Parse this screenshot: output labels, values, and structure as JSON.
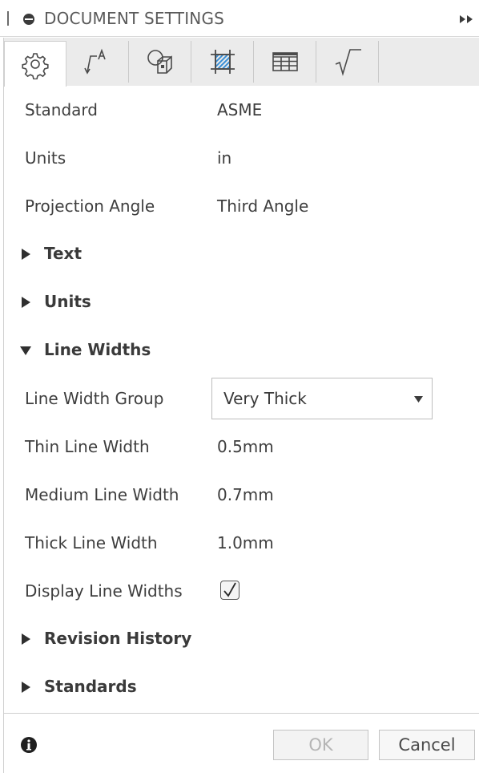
{
  "header": {
    "title": "DOCUMENT SETTINGS",
    "icons": {
      "grip": "grip-icon",
      "settings": "record-icon",
      "expand": "expand-icon"
    }
  },
  "tabs": [
    {
      "icon": "gear-icon"
    },
    {
      "icon": "text-dimension-icon"
    },
    {
      "icon": "view-projection-icon"
    },
    {
      "icon": "hatch-frame-icon"
    },
    {
      "icon": "table-icon"
    },
    {
      "icon": "square-root-icon"
    }
  ],
  "general": {
    "standard_label": "Standard",
    "standard_value": "ASME",
    "units_label": "Units",
    "units_value": "in",
    "projection_label": "Projection Angle",
    "projection_value": "Third Angle"
  },
  "sections": {
    "text": "Text",
    "units": "Units",
    "line_widths": "Line Widths",
    "revision_history": "Revision History",
    "standards": "Standards"
  },
  "line_widths": {
    "group_label": "Line Width Group",
    "group_value": "Very Thick",
    "thin_label": "Thin Line Width",
    "thin_value": "0.5mm",
    "medium_label": "Medium Line Width",
    "medium_value": "0.7mm",
    "thick_label": "Thick Line Width",
    "thick_value": "1.0mm",
    "display_label": "Display Line Widths",
    "display_checked": true
  },
  "footer": {
    "ok_label": "OK",
    "cancel_label": "Cancel",
    "ok_enabled": false
  },
  "colors": {
    "text": "#3e3e3e",
    "tab_strip": "#ebebeb",
    "disabled_text": "#b5b5b5",
    "hatch_blue": "#3a8fd6"
  }
}
